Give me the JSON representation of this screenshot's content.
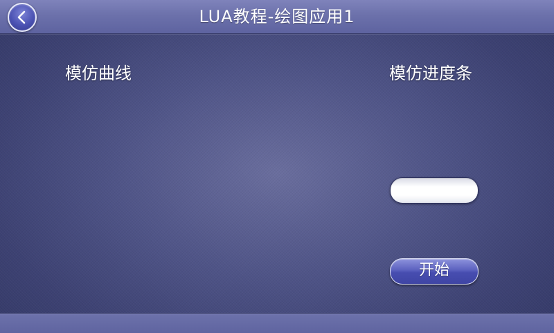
{
  "header": {
    "title": "LUA教程-绘图应用1",
    "back_icon": "chevron-left-icon"
  },
  "main": {
    "curve_label": "模仿曲线",
    "progress_label": "模仿进度条",
    "progress": {
      "value_percent": 0
    },
    "start_button_label": "开始"
  },
  "colors": {
    "titlebar": "#6c71ab",
    "background": "#4f5487",
    "button_accent": "#4b52b3",
    "text": "#ffffff"
  }
}
